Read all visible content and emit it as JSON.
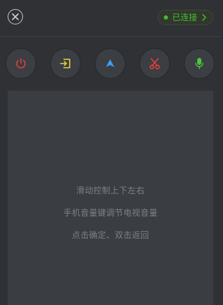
{
  "header": {
    "close_icon": "close-icon",
    "status": {
      "label": "已连接",
      "color": "#3fc12b",
      "icon": "chevron-right-icon"
    }
  },
  "actions": [
    {
      "name": "power",
      "icon": "power-icon",
      "color": "#e2403e"
    },
    {
      "name": "input-source",
      "icon": "input-source-icon",
      "color": "#e8d23a"
    },
    {
      "name": "navigate",
      "icon": "navigation-arrow-icon",
      "color": "#3d9df2"
    },
    {
      "name": "scissors",
      "icon": "scissors-icon",
      "color": "#e2403e"
    },
    {
      "name": "voice",
      "icon": "microphone-icon",
      "color": "#4cc43f"
    }
  ],
  "touchpad": {
    "hints": [
      "滑动控制上下左右",
      "手机音量键调节电视音量",
      "点击确定、双击返回"
    ]
  }
}
